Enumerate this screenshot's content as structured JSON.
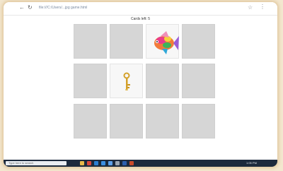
{
  "browser": {
    "url": "file:///C:/Users/...jpg game.html",
    "back_icon": "back-arrow-icon",
    "refresh_icon": "refresh-icon",
    "bookmark_icon": "star-icon",
    "menu_icon": "more-menu-icon"
  },
  "page": {
    "title": "Cards left: 5"
  },
  "game": {
    "cards": [
      {
        "state": "hidden"
      },
      {
        "state": "hidden"
      },
      {
        "state": "revealed",
        "image": "fish-icon"
      },
      {
        "state": "hidden"
      },
      {
        "state": "hidden"
      },
      {
        "state": "revealed",
        "image": "key-icon"
      },
      {
        "state": "hidden"
      },
      {
        "state": "hidden"
      },
      {
        "state": "hidden"
      },
      {
        "state": "hidden"
      },
      {
        "state": "hidden"
      },
      {
        "state": "hidden"
      }
    ],
    "card_back_color": "#d6d6d6"
  },
  "taskbar": {
    "search_placeholder": "Type here to search",
    "apps": [
      "windows-icon",
      "file-explorer-icon",
      "chrome-icon",
      "edge-icon",
      "store-icon",
      "mail-icon",
      "settings-icon",
      "word-icon",
      "powerpoint-icon"
    ],
    "clock": "1:05 PM"
  }
}
